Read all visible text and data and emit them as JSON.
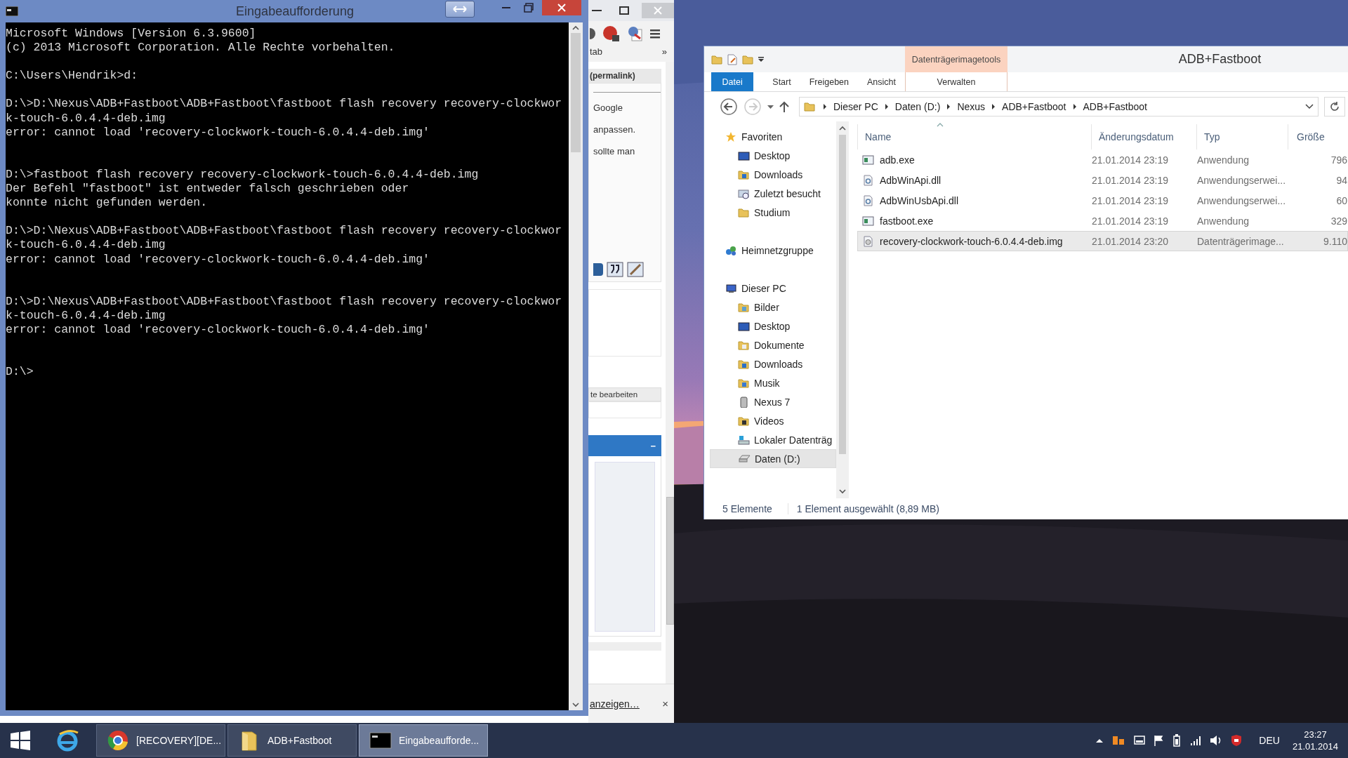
{
  "cmd_window": {
    "title": "Eingabeaufforderung",
    "output": "Microsoft Windows [Version 6.3.9600]\n(c) 2013 Microsoft Corporation. Alle Rechte vorbehalten.\n\nC:\\Users\\Hendrik>d:\n\nD:\\>D:\\Nexus\\ADB+Fastboot\\ADB+Fastboot\\fastboot flash recovery recovery-clockwor\nk-touch-6.0.4.4-deb.img\nerror: cannot load 'recovery-clockwork-touch-6.0.4.4-deb.img'\n\n\nD:\\>fastboot flash recovery recovery-clockwork-touch-6.0.4.4-deb.img\nDer Befehl \"fastboot\" ist entweder falsch geschrieben oder\nkonnte nicht gefunden werden.\n\nD:\\>D:\\Nexus\\ADB+Fastboot\\ADB+Fastboot\\fastboot flash recovery recovery-clockwor\nk-touch-6.0.4.4-deb.img\nerror: cannot load 'recovery-clockwork-touch-6.0.4.4-deb.img'\n\n\nD:\\>D:\\Nexus\\ADB+Fastboot\\ADB+Fastboot\\fastboot flash recovery recovery-clockwor\nk-touch-6.0.4.4-deb.img\nerror: cannot load 'recovery-clockwork-touch-6.0.4.4-deb.img'\n\n\nD:\\>"
  },
  "browser_window": {
    "bookmark_label": "tab",
    "bookmark_overflow": "»",
    "permalink": "(permalink)",
    "text_lines": [
      "Google",
      "anpassen.",
      "sollte man"
    ],
    "edit_label": "te bearbeiten",
    "panel_collapse": "−",
    "bar_link": "anzeigen…",
    "bar_close": "×"
  },
  "explorer": {
    "title": "ADB+Fastboot",
    "context_group": "Datenträgerimagetools",
    "ribbon_tabs": [
      {
        "label": "Datei",
        "kind": "file"
      },
      {
        "label": "Start",
        "kind": "tab"
      },
      {
        "label": "Freigeben",
        "kind": "tab"
      },
      {
        "label": "Ansicht",
        "kind": "tab"
      },
      {
        "label": "Verwalten",
        "kind": "context"
      }
    ],
    "breadcrumb": [
      "Dieser PC",
      "Daten (D:)",
      "Nexus",
      "ADB+Fastboot",
      "ADB+Fastboot"
    ],
    "nav": [
      {
        "label": "Favoriten",
        "kind": "favorites",
        "selected": false,
        "children": [
          {
            "label": "Desktop",
            "kind": "desktop",
            "selected": false
          },
          {
            "label": "Downloads",
            "kind": "downloads",
            "selected": false
          },
          {
            "label": "Zuletzt besucht",
            "kind": "recent",
            "selected": false
          },
          {
            "label": "Studium",
            "kind": "folder",
            "selected": false
          }
        ]
      },
      {
        "label": "Heimnetzgruppe",
        "kind": "homegroup",
        "selected": false
      },
      {
        "label": "Dieser PC",
        "kind": "computer",
        "selected": false,
        "children": [
          {
            "label": "Bilder",
            "kind": "pictures",
            "selected": false
          },
          {
            "label": "Desktop",
            "kind": "desktop",
            "selected": false
          },
          {
            "label": "Dokumente",
            "kind": "documents",
            "selected": false
          },
          {
            "label": "Downloads",
            "kind": "downloads",
            "selected": false
          },
          {
            "label": "Musik",
            "kind": "music",
            "selected": false
          },
          {
            "label": "Nexus 7",
            "kind": "device",
            "selected": false
          },
          {
            "label": "Videos",
            "kind": "videos",
            "selected": false
          },
          {
            "label": "Lokaler Datenträg",
            "kind": "system_drive",
            "selected": false
          },
          {
            "label": "Daten (D:)",
            "kind": "drive",
            "selected": true
          }
        ]
      }
    ],
    "columns": [
      "Name",
      "Änderungsdatum",
      "Typ",
      "Größe"
    ],
    "files": [
      {
        "name": "adb.exe",
        "modified": "21.01.2014 23:19",
        "type": "Anwendung",
        "size": "796",
        "kind": "exe",
        "selected": false
      },
      {
        "name": "AdbWinApi.dll",
        "modified": "21.01.2014 23:19",
        "type": "Anwendungserwei...",
        "size": "94",
        "kind": "dll",
        "selected": false
      },
      {
        "name": "AdbWinUsbApi.dll",
        "modified": "21.01.2014 23:19",
        "type": "Anwendungserwei...",
        "size": "60",
        "kind": "dll",
        "selected": false
      },
      {
        "name": "fastboot.exe",
        "modified": "21.01.2014 23:19",
        "type": "Anwendung",
        "size": "329",
        "kind": "exe",
        "selected": false
      },
      {
        "name": "recovery-clockwork-touch-6.0.4.4-deb.img",
        "modified": "21.01.2014 23:20",
        "type": "Datenträgerimage...",
        "size": "9.110",
        "kind": "img",
        "selected": true
      }
    ],
    "status": [
      "5 Elemente",
      "1 Element ausgewählt (8,89 MB)"
    ]
  },
  "taskbar": {
    "buttons": [
      {
        "label": "[RECOVERY][DE...",
        "kind": "chrome",
        "active": false
      },
      {
        "label": "ADB+Fastboot",
        "kind": "explorer",
        "active": false
      },
      {
        "label": "Eingabeaufforde...",
        "kind": "console",
        "active": true
      }
    ],
    "language": "DEU",
    "time": "23:27",
    "date": "21.01.2014"
  }
}
